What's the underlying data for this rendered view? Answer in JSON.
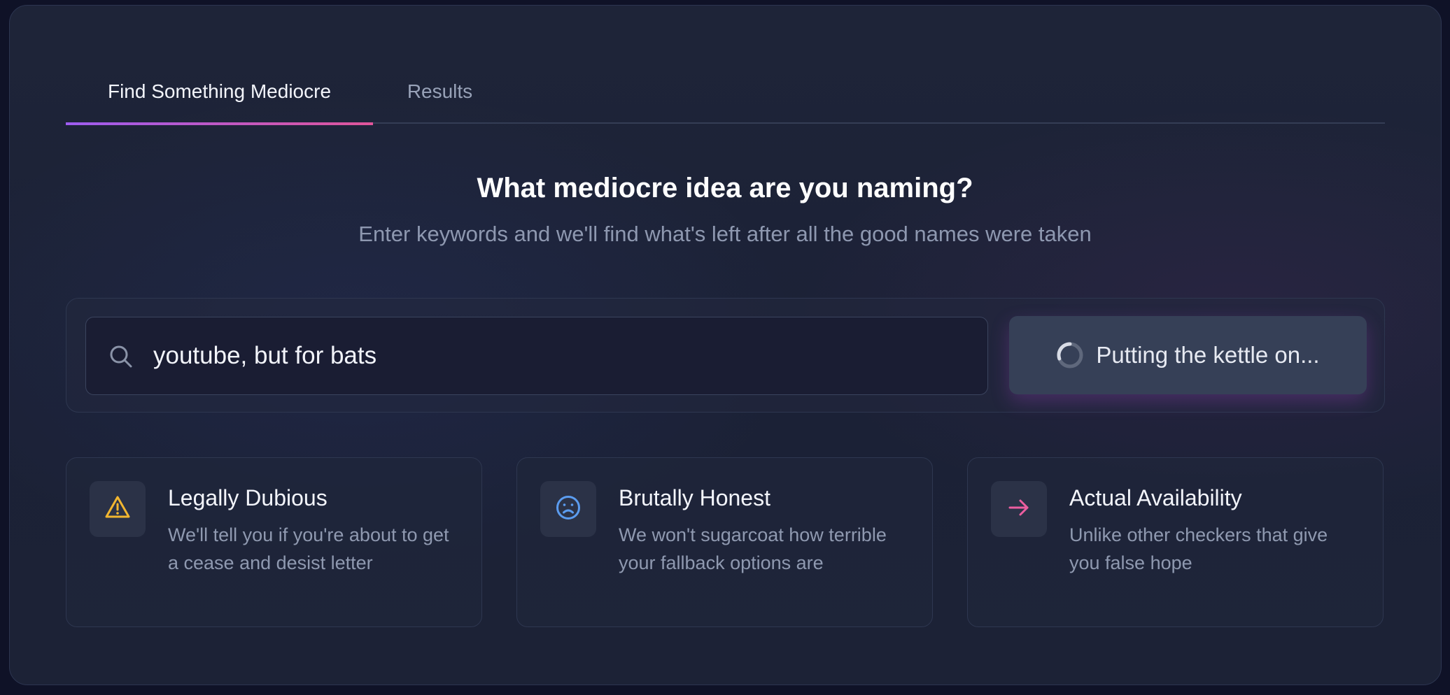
{
  "tabs": [
    {
      "label": "Find Something Mediocre",
      "active": true
    },
    {
      "label": "Results",
      "active": false
    }
  ],
  "heading": "What mediocre idea are you naming?",
  "subheading": "Enter keywords and we'll find what's left after all the good names were taken",
  "search": {
    "value": "youtube, but for bats",
    "icon": "search-icon",
    "button_label": "Putting the kettle on...",
    "button_icon": "spinner-icon"
  },
  "features": [
    {
      "icon": "warning-icon",
      "icon_color": "#f2b630",
      "title": "Legally Dubious",
      "description": "We'll tell you if you're about to get a cease and desist letter"
    },
    {
      "icon": "frown-icon",
      "icon_color": "#5b9cf0",
      "title": "Brutally Honest",
      "description": "We won't sugarcoat how terrible your fallback options are"
    },
    {
      "icon": "arrow-right-icon",
      "icon_color": "#ec5ea0",
      "title": "Actual Availability",
      "description": "Unlike other checkers that give you false hope"
    }
  ],
  "colors": {
    "tab_gradient_start": "#9d5cf0",
    "tab_gradient_end": "#e0559a",
    "background": "#1e2438"
  }
}
